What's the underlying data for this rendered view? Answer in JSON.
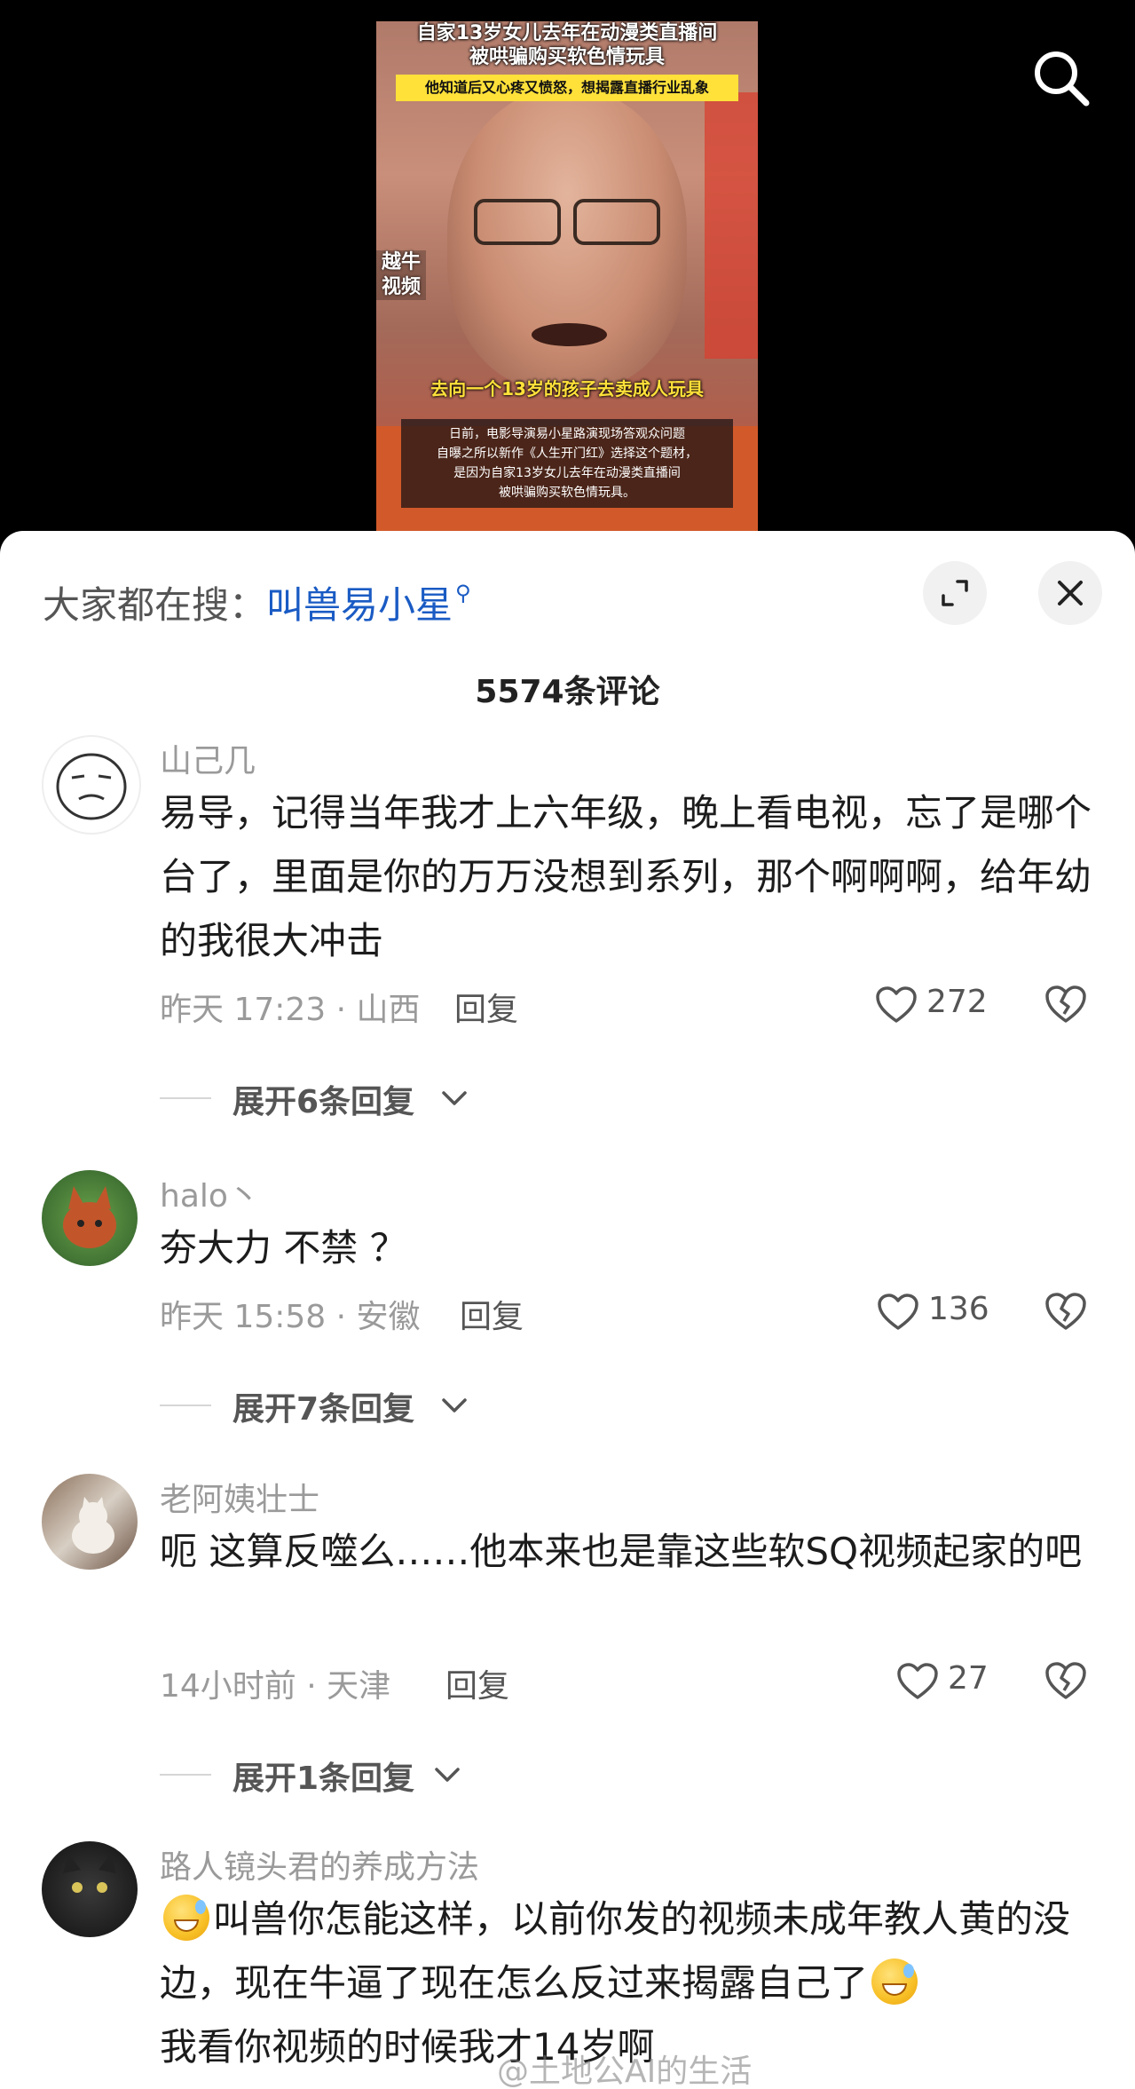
{
  "video": {
    "title_line1": "自家13岁女儿去年在动漫类直播间",
    "title_line2": "被哄骗购买软色情玩具",
    "subtitle": "他知道后又心疼又愤怒，想揭露直播行业乱象",
    "watermark": "越牛视频",
    "caption": "去向一个13岁的孩子去卖成人玩具",
    "desc_line1": "日前，电影导演易小星路演现场答观众问题",
    "desc_line2": "自曝之所以新作《人生开门红》选择这个题材，",
    "desc_line3": "是因为自家13岁女儿去年在动漫类直播间",
    "desc_line4": "被哄骗购买软色情玩具。"
  },
  "search": {
    "prefix": "大家都在搜：",
    "query": "叫兽易小星",
    "query_icon": "search-icon"
  },
  "panel": {
    "comment_count": "5574条评论",
    "expand_icon": "expand-icon",
    "close_icon": "close-icon"
  },
  "comments": [
    {
      "username": "山己几",
      "text": "易导，记得当年我才上六年级，晚上看电视，忘了是哪个台了，里面是你的万万没想到系列，那个啊啊啊，给年幼的我很大冲击",
      "meta": "昨天 17:23 · 山西",
      "reply_label": "回复",
      "likes": "272",
      "expand_label": "展开6条回复"
    },
    {
      "username": "halo丶",
      "text": "夯大力 不禁 ？",
      "meta": "昨天 15:58 · 安徽",
      "reply_label": "回复",
      "likes": "136",
      "expand_label": "展开7条回复"
    },
    {
      "username": "老阿姨壮士",
      "text": "呃 这算反噬么……他本来也是靠这些软SQ视频起家的吧",
      "meta": "14小时前 · 天津",
      "reply_label": "回复",
      "likes": "27",
      "expand_label": "展开1条回复"
    },
    {
      "username": "路人镜头君的养成方法",
      "text_part1": "叫兽你怎能这样，以前你发的视频未成年教人黄的没边，现在牛逼了现在怎么反过来揭露自己了",
      "text_part2": "我看你视频的时候我才14岁啊",
      "emoji_name": "grin-sweat-emoji"
    }
  ],
  "watermark": "@土地公AI的生活"
}
